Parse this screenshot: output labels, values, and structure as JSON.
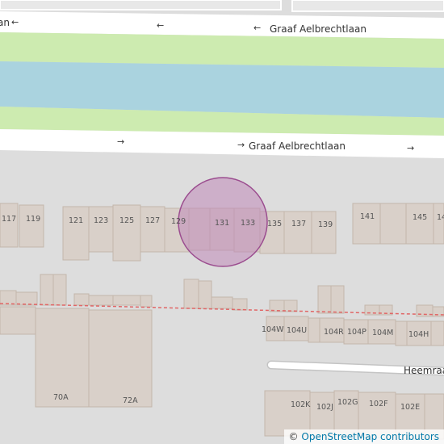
{
  "streets": {
    "north_fragment": "an",
    "label_north": "Graaf Aelbrechtlaan",
    "label_south": "Graaf Aelbrechtlaan",
    "heemraad": "Heemraad"
  },
  "arrows": {
    "left": "←",
    "right": "→"
  },
  "house_numbers": {
    "n117": "117",
    "n119": "119",
    "n121": "121",
    "n123": "123",
    "n125": "125",
    "n127": "127",
    "n129": "129",
    "n131": "131",
    "n133": "133",
    "n135": "135",
    "n137": "137",
    "n139": "139",
    "n141": "141",
    "n145": "145",
    "n14x": "14",
    "n104w": "104W",
    "n104u": "104U",
    "n104r": "104R",
    "n104p": "104P",
    "n104m": "104M",
    "n104h": "104H",
    "n102k": "102K",
    "n102j": "102J",
    "n102g": "102G",
    "n102f": "102F",
    "n102e": "102E",
    "n70a": "70A",
    "n72a": "72A"
  },
  "highlight": {
    "fill": "#c088b8",
    "stroke": "#9b4d8f"
  },
  "colors": {
    "land": "#dddddd",
    "road": "#ffffff",
    "water": "#aad3df",
    "grass": "#cdebb0",
    "building": "#d9d0c9",
    "building_outline": "#c4b6ab",
    "rail": "#e06666"
  },
  "attribution": {
    "symbol": "©",
    "text": "OpenStreetMap contributors"
  }
}
